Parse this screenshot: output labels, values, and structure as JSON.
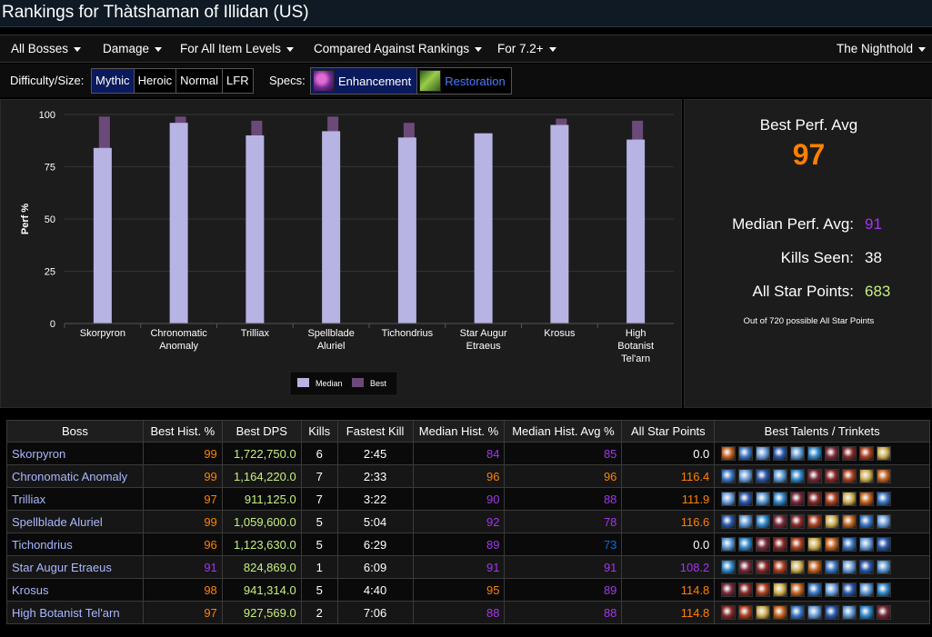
{
  "title": "Rankings for Thàtshaman of Illidan (US)",
  "menu": {
    "bosses": "All Bosses",
    "metric": "Damage",
    "item_levels": "For All Item Levels",
    "compare": "Compared Against Rankings",
    "patch": "For 7.2+",
    "zone": "The Nighthold"
  },
  "filters": {
    "difficulty_label": "Difficulty/Size:",
    "difficulties": [
      "Mythic",
      "Heroic",
      "Normal",
      "LFR"
    ],
    "specs_label": "Specs:",
    "specs": [
      "Enhancement",
      "Restoration"
    ]
  },
  "chart_data": {
    "type": "bar",
    "ylabel": "Perf %",
    "ylim": [
      0,
      100
    ],
    "yticks": [
      0,
      25,
      50,
      75,
      100
    ],
    "categories": [
      "Skorpyron",
      "Chronomatic Anomaly",
      "Trilliax",
      "Spellblade Aluriel",
      "Tichondrius",
      "Star Augur Etraeus",
      "Krosus",
      "High Botanist Tel'arn"
    ],
    "category_lines": [
      [
        "Skorpyron"
      ],
      [
        "Chronomatic",
        "Anomaly"
      ],
      [
        "Trilliax"
      ],
      [
        "Spellblade",
        "Aluriel"
      ],
      [
        "Tichondrius"
      ],
      [
        "Star Augur",
        "Etraeus"
      ],
      [
        "Krosus"
      ],
      [
        "High",
        "Botanist",
        "Tel'arn"
      ]
    ],
    "series": [
      {
        "name": "Median",
        "values": [
          84,
          96,
          90,
          92,
          89,
          91,
          95,
          88
        ],
        "color": "#b7b3e3"
      },
      {
        "name": "Best",
        "values": [
          99,
          99,
          97,
          99,
          96,
          91,
          98,
          97
        ],
        "color": "#6b4a7a"
      }
    ],
    "grid": true,
    "legend": "bottom"
  },
  "stats": {
    "best_label": "Best Perf. Avg",
    "best_value": "97",
    "median_label": "Median Perf. Avg:",
    "median_value": "91",
    "kills_label": "Kills Seen:",
    "kills_value": "38",
    "points_label": "All Star Points:",
    "points_value": "683",
    "footnote": "Out of 720 possible All Star Points"
  },
  "table": {
    "headers": [
      "Boss",
      "Best Hist. %",
      "Best DPS",
      "Kills",
      "Fastest Kill",
      "Median Hist. %",
      "Median Hist. Avg %",
      "All Star Points",
      "Best Talents / Trinkets"
    ],
    "rows": [
      {
        "boss": "Skorpyron",
        "best": "99",
        "dps": "1,722,750.0",
        "kills": "6",
        "fastest": "2:45",
        "median": "84",
        "median_avg": "85",
        "points": "0.0"
      },
      {
        "boss": "Chronomatic Anomaly",
        "best": "99",
        "dps": "1,164,220.0",
        "kills": "7",
        "fastest": "2:33",
        "median": "96",
        "median_avg": "96",
        "points": "116.4"
      },
      {
        "boss": "Trilliax",
        "best": "97",
        "dps": "911,125.0",
        "kills": "7",
        "fastest": "3:22",
        "median": "90",
        "median_avg": "88",
        "points": "111.9"
      },
      {
        "boss": "Spellblade Aluriel",
        "best": "99",
        "dps": "1,059,600.0",
        "kills": "5",
        "fastest": "5:04",
        "median": "92",
        "median_avg": "78",
        "points": "116.6"
      },
      {
        "boss": "Tichondrius",
        "best": "96",
        "dps": "1,123,630.0",
        "kills": "5",
        "fastest": "6:29",
        "median": "89",
        "median_avg": "73",
        "points": "0.0"
      },
      {
        "boss": "Star Augur Etraeus",
        "best": "91",
        "dps": "824,869.0",
        "kills": "1",
        "fastest": "6:09",
        "median": "91",
        "median_avg": "91",
        "points": "108.2"
      },
      {
        "boss": "Krosus",
        "best": "98",
        "dps": "941,314.0",
        "kills": "5",
        "fastest": "4:40",
        "median": "95",
        "median_avg": "89",
        "points": "114.8"
      },
      {
        "boss": "High Botanist Tel'arn",
        "best": "97",
        "dps": "927,569.0",
        "kills": "2",
        "fastest": "7:06",
        "median": "88",
        "median_avg": "88",
        "points": "114.8"
      }
    ]
  },
  "colors": {
    "orange": "#ff8000",
    "purple": "#a335ee",
    "blue": "#0070dd",
    "green": "#c6f080",
    "link": "#aab8ff"
  }
}
